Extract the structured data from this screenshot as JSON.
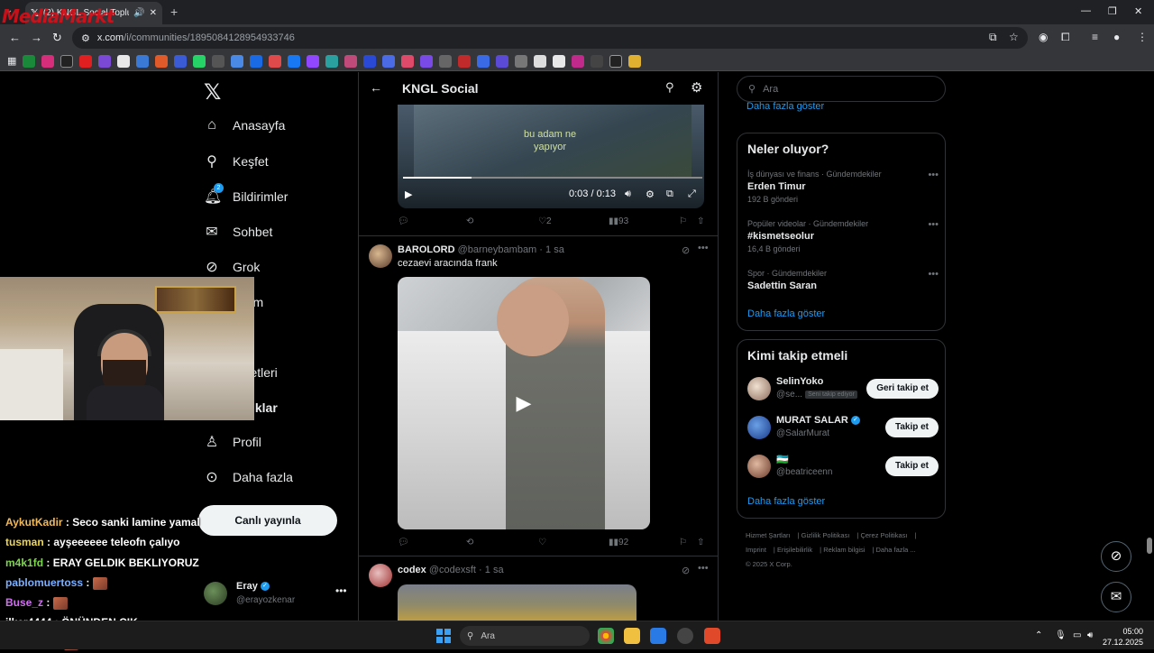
{
  "browser": {
    "tab_title": "(2) KNGL Social Topluluk / X",
    "url_prefix": "x.com",
    "url_path": "/i/communities/1895084128954933746",
    "overlay_brand": "MediaMarkt"
  },
  "sidebar": {
    "items": [
      {
        "label": "Anasayfa",
        "icon": "home-icon"
      },
      {
        "label": "Keşfet",
        "icon": "search-icon"
      },
      {
        "label": "Bildirimler",
        "icon": "bell-icon",
        "badge": "2"
      },
      {
        "label": "Sohbet",
        "icon": "mail-icon"
      },
      {
        "label": "Grok",
        "icon": "grok-icon"
      },
      {
        "label": "mium",
        "icon": "premium-icon"
      },
      {
        "label": "eler",
        "icon": "lists-icon"
      },
      {
        "label": "şaretleri",
        "icon": "bookmark-icon"
      },
      {
        "label": "luluklar",
        "icon": "communities-icon"
      },
      {
        "label": "Profil",
        "icon": "profile-icon"
      },
      {
        "label": "Daha fazla",
        "icon": "more-circle-icon"
      }
    ],
    "post_button": "Canlı yayınla",
    "account_name": "Eray",
    "account_handle": "@erayozkenar"
  },
  "feed": {
    "header_title": "KNGL Social",
    "video1": {
      "caption_line1": "bu adam ne",
      "caption_line2": "yapıyor",
      "time": "0:03 / 0:13",
      "progress": 0.23,
      "likes": "2",
      "views": "93"
    },
    "tweet2": {
      "name": "BAROLORD",
      "handle": "@barneybambam",
      "time": "1 sa",
      "text": "cezaevi aracında frank",
      "views": "92"
    },
    "tweet3": {
      "name": "codex",
      "handle": "@codexsft",
      "time": "1 sa"
    }
  },
  "right": {
    "search_placeholder": "Ara",
    "show_more_top": "Daha fazla göster",
    "trends_title": "Neler oluyor?",
    "trends": [
      {
        "category": "İş dünyası ve finans · Gündemdekiler",
        "name": "Erden Timur",
        "count": "192 B gönderi"
      },
      {
        "category": "Popüler videolar · Gündemdekiler",
        "name": "#kismetseolur",
        "count": "16,4 B gönderi"
      },
      {
        "category": "Spor · Gündemdekiler",
        "name": "Sadettin Saran",
        "count": ""
      }
    ],
    "trends_more": "Daha fazla göster",
    "follow_title": "Kimi takip etmeli",
    "follow": [
      {
        "name": "SelinYoko",
        "handle": "@se...",
        "tag": "Seni takip ediyor",
        "button": "Geri takip et"
      },
      {
        "name": "MURAT SALAR",
        "handle": "@SalarMurat",
        "tag": "",
        "button": "Takip et"
      },
      {
        "name": "🇺🇿",
        "handle": "@beatriceenn",
        "tag": "",
        "button": "Takip et"
      }
    ],
    "follow_more": "Daha fazla göster",
    "footer": [
      "Hizmet Şartları",
      "Gizlilik Politikası",
      "Çerez Politikası",
      "Imprint",
      "Erişilebilirlik",
      "Reklam bilgisi",
      "Daha fazla ...",
      "© 2025 X Corp."
    ]
  },
  "chat": [
    {
      "user": "AykutKadir",
      "color": "#f0b85a",
      "text": ": Seco sanki lamine yamal"
    },
    {
      "user": "tusman",
      "color": "#f0d84a",
      "text": ": ayşeeeeee teleofn çalıyo"
    },
    {
      "user": "m4k1fd",
      "color": "#7cd84a",
      "text": ": ERAY GELDIK BEKLIYORUZ"
    },
    {
      "user": "pablomuertoss",
      "color": "#7ab0ff",
      "text": ":"
    },
    {
      "user": "Buse_z",
      "color": "#d070f0",
      "text": ":"
    },
    {
      "user": "ilker4444",
      "color": "#ffffff",
      "text": ": ÖNÜNDEN ÇIK"
    },
    {
      "user": "T20Carso",
      "color": "#ffffff",
      "text": ":"
    }
  ],
  "taskbar": {
    "search": "Ara",
    "time": "05:00",
    "date": "27.12.2025"
  }
}
